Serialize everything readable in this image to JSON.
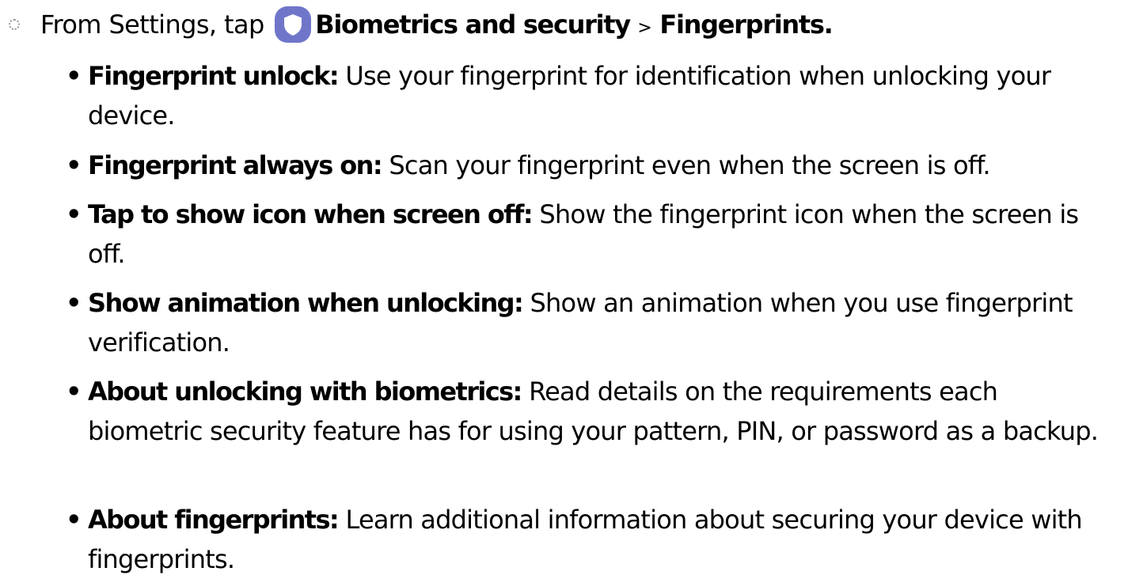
{
  "step": {
    "intro": "From Settings, tap",
    "icon": "shield-icon",
    "icon_color": "#6f76c9",
    "menu": "Biometrics and security",
    "separator": ">",
    "submenu": "Fingerprints."
  },
  "options": [
    {
      "term": "Fingerprint unlock:",
      "description": "Use your fingerprint for identification when unlocking your device."
    },
    {
      "term": "Fingerprint always on:",
      "description": "Scan your fingerprint even when the screen is off."
    },
    {
      "term": "Tap to show icon when screen off:",
      "description": "Show the fingerprint icon when the screen is off."
    },
    {
      "term": "Show animation when unlocking:",
      "description": "Show an animation when you use fingerprint verification."
    },
    {
      "term": "About unlocking with biometrics:",
      "description": "Read details on the requirements each biometric security feature has for using your pattern, PIN, or password as a backup."
    },
    {
      "term": "About fingerprints:",
      "description": "Learn additional information about securing your device with fingerprints."
    }
  ]
}
